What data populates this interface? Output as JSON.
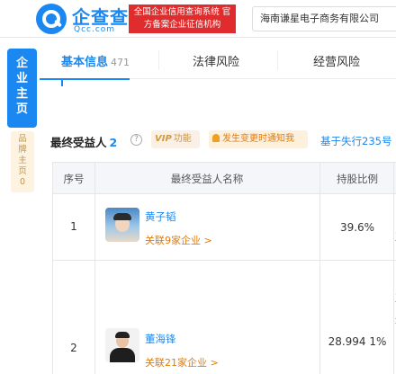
{
  "header": {
    "logo_cn": "企查查",
    "logo_en": "Qcc.com",
    "official_text": "全国企业信用查询系统 官方备案企业征信机构",
    "company_name": "海南谦星电子商务有限公司"
  },
  "side_tabs": {
    "main": [
      "企",
      "业",
      "主",
      "页"
    ],
    "sub": [
      "品",
      "牌",
      "主",
      "页",
      "0"
    ]
  },
  "nav": {
    "tabs": [
      {
        "label": "基本信息",
        "count": "471"
      },
      {
        "label": "法律风险"
      },
      {
        "label": "经营风险"
      }
    ]
  },
  "section": {
    "title": "最终受益人",
    "count": "2",
    "help": "?",
    "vip_label": "VIP",
    "vip_text": "功能",
    "notify_text": "发生变更时通知我",
    "link_text": "基于失行235号"
  },
  "table": {
    "headers": [
      "序号",
      "最终受益人名称",
      "持股比例"
    ],
    "rows": [
      {
        "no": "1",
        "name": "黄子韬",
        "link": "关联9家企业 >",
        "ratio": "39.6%",
        "cut": [
          "目",
          "直"
        ]
      },
      {
        "no": "2",
        "name": "董海锋",
        "link": "关联21家企业 >",
        "ratio": "28.994 1%",
        "cut": [
          "目",
          "直",
          "炬",
          "间",
          "目",
          "直"
        ]
      }
    ]
  },
  "colors": {
    "brand": "#1a88f0",
    "orange": "#e07b10",
    "red": "#e02c2c"
  }
}
